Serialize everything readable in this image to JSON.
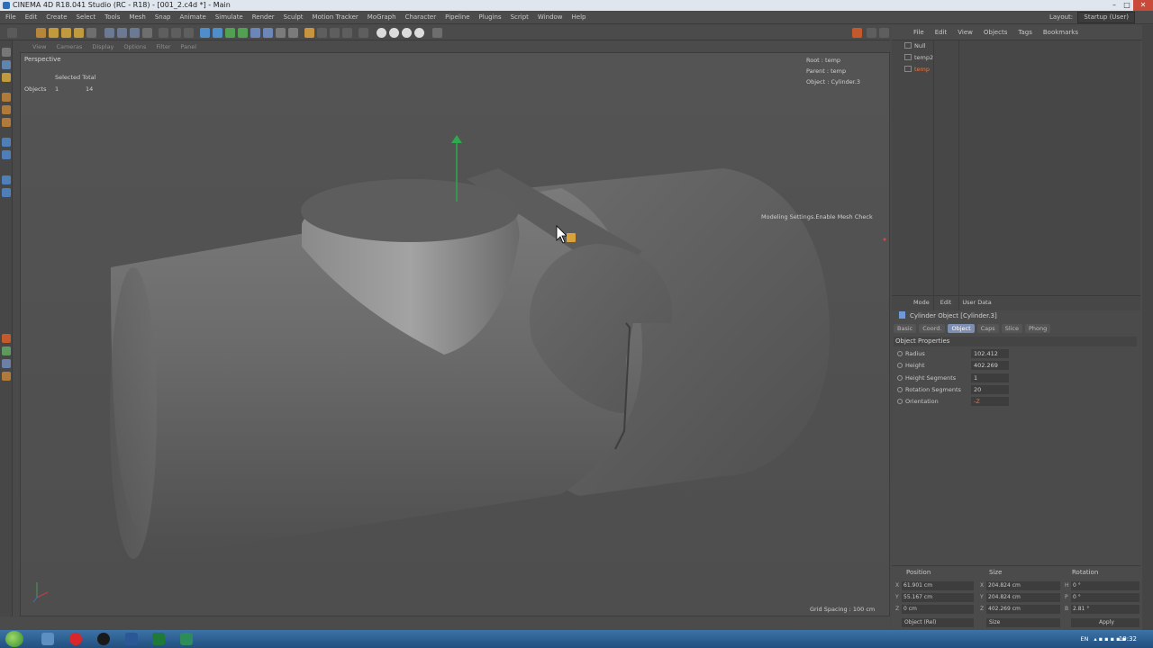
{
  "window": {
    "title": "CINEMA 4D R18.041 Studio (RC - R18) - [001_2.c4d *] - Main"
  },
  "menu": [
    "File",
    "Edit",
    "Create",
    "Select",
    "Tools",
    "Mesh",
    "Snap",
    "Animate",
    "Simulate",
    "Render",
    "Sculpt",
    "Motion Tracker",
    "MoGraph",
    "Character",
    "Pipeline",
    "Plugins",
    "Script",
    "Window",
    "Help"
  ],
  "layout": {
    "label": "Layout:",
    "value": "Startup (User)"
  },
  "viewport": {
    "menu": [
      "View",
      "Cameras",
      "Display",
      "Options",
      "Filter",
      "Panel"
    ],
    "name": "Perspective",
    "stats": {
      "header": "Selected Total",
      "row_label": "Objects",
      "selected": "1",
      "total": "14"
    },
    "info": {
      "root": "Root : temp",
      "parent": "Parent : temp",
      "object": "Object : Cylinder.3"
    },
    "tooltip": "Modeling Settings.Enable Mesh Check",
    "grid_spacing": "Grid Spacing : 100 cm"
  },
  "object_manager": {
    "menu": [
      "File",
      "Edit",
      "View",
      "Objects",
      "Tags",
      "Bookmarks"
    ],
    "objects": [
      "Null",
      "temp2",
      "temp"
    ]
  },
  "attributes": {
    "menu": [
      "Mode",
      "Edit",
      "User Data"
    ],
    "title": "Cylinder Object [Cylinder.3]",
    "tabs": [
      "Basic",
      "Coord.",
      "Object",
      "Caps",
      "Slice",
      "Phong"
    ],
    "active_tab": "Object",
    "section": "Object Properties",
    "props": [
      {
        "label": "Radius",
        "value": "102.412"
      },
      {
        "label": "Height",
        "value": "402.269"
      },
      {
        "label": "Height Segments",
        "value": "1"
      },
      {
        "label": "Rotation Segments",
        "value": "20"
      },
      {
        "label": "Orientation",
        "value": "-Z"
      }
    ]
  },
  "coords": {
    "headers": [
      "Position",
      "Size",
      "Rotation"
    ],
    "position": [
      {
        "axis": "X",
        "value": "61.901 cm"
      },
      {
        "axis": "Y",
        "value": "55.167 cm"
      },
      {
        "axis": "Z",
        "value": "0 cm"
      }
    ],
    "size": [
      {
        "axis": "X",
        "value": "204.824 cm"
      },
      {
        "axis": "Y",
        "value": "204.824 cm"
      },
      {
        "axis": "Z",
        "value": "402.269 cm"
      }
    ],
    "rotation": [
      {
        "axis": "H",
        "value": "0 °"
      },
      {
        "axis": "P",
        "value": "0 °"
      },
      {
        "axis": "B",
        "value": "2.81 °"
      }
    ],
    "mode": "Object (Rel)",
    "size_mode": "Size",
    "apply": "Apply"
  },
  "taskbar": {
    "lang": "EN",
    "time": "10:32"
  }
}
